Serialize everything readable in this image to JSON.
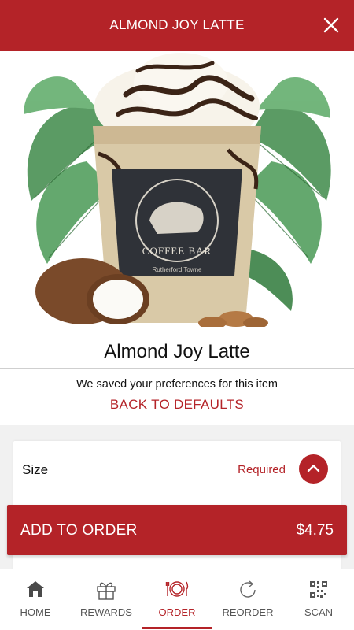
{
  "header": {
    "title": "ALMOND JOY LATTE"
  },
  "hero": {
    "cup_text": "COFFEE BAR",
    "cup_subtext": "Rutherford Towne"
  },
  "product": {
    "name": "Almond Joy Latte"
  },
  "preferences": {
    "note": "We saved your preferences for this item",
    "reset_label": "BACK TO DEFAULTS"
  },
  "options": {
    "size_label": "Size",
    "required_label": "Required"
  },
  "cta": {
    "label": "ADD TO ORDER",
    "price": "$4.75"
  },
  "tabbar": {
    "tabs": [
      {
        "label": "HOME",
        "icon": "home-icon"
      },
      {
        "label": "REWARDS",
        "icon": "gift-icon"
      },
      {
        "label": "ORDER",
        "icon": "dining-icon",
        "active": true
      },
      {
        "label": "REORDER",
        "icon": "refresh-icon"
      },
      {
        "label": "SCAN",
        "icon": "qr-code-icon"
      }
    ]
  },
  "colors": {
    "brand": "#b42328",
    "background": "#ffffff",
    "panel": "#f1f1f1"
  }
}
